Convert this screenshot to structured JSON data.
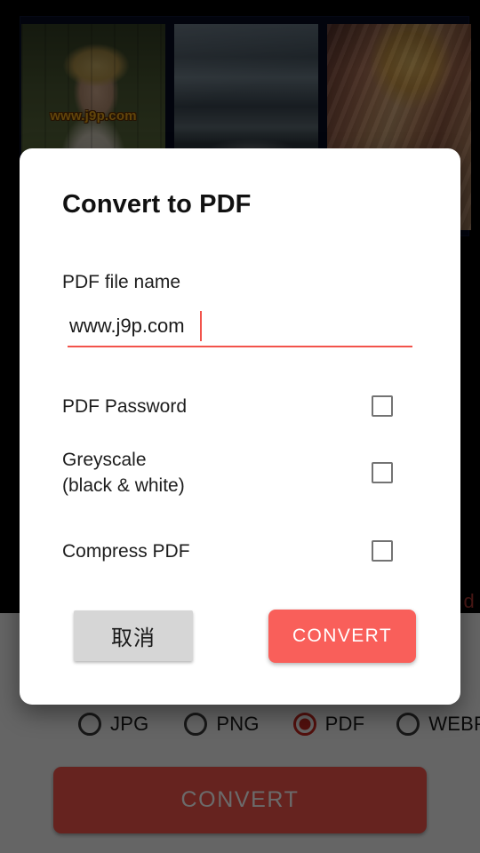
{
  "app": {
    "background_color": "#070b1f",
    "scrim_color": "rgba(0,0,0,0.58)",
    "accent_color": "#f2534b"
  },
  "gallery": {
    "thumbnails": [
      {
        "name": "woman-in-straw-hat-park",
        "watermark": "www.j9p.com"
      },
      {
        "name": "mountain-lake-cloudy",
        "watermark": ""
      },
      {
        "name": "slot-canyon-sandstone",
        "watermark": ""
      }
    ]
  },
  "background_status": {
    "partial_text": "d"
  },
  "bottom_bar": {
    "formats": [
      {
        "label": "JPG",
        "selected": false
      },
      {
        "label": "PNG",
        "selected": false
      },
      {
        "label": "PDF",
        "selected": true
      },
      {
        "label": "WEBP",
        "selected": false
      }
    ],
    "convert_label": "CONVERT"
  },
  "dialog": {
    "title": "Convert to PDF",
    "filename": {
      "label": "PDF file name",
      "value": "www.j9p.com",
      "placeholder": "PDF file name",
      "underline_color": "#f2534b"
    },
    "options": [
      {
        "name": "pdf-password",
        "label": "PDF Password",
        "checked": false
      },
      {
        "name": "greyscale",
        "label": "Greyscale\n(black & white)",
        "checked": false
      },
      {
        "name": "compress-pdf",
        "label": "Compress PDF",
        "checked": false
      }
    ],
    "buttons": {
      "cancel": "取消",
      "convert": "CONVERT"
    }
  }
}
